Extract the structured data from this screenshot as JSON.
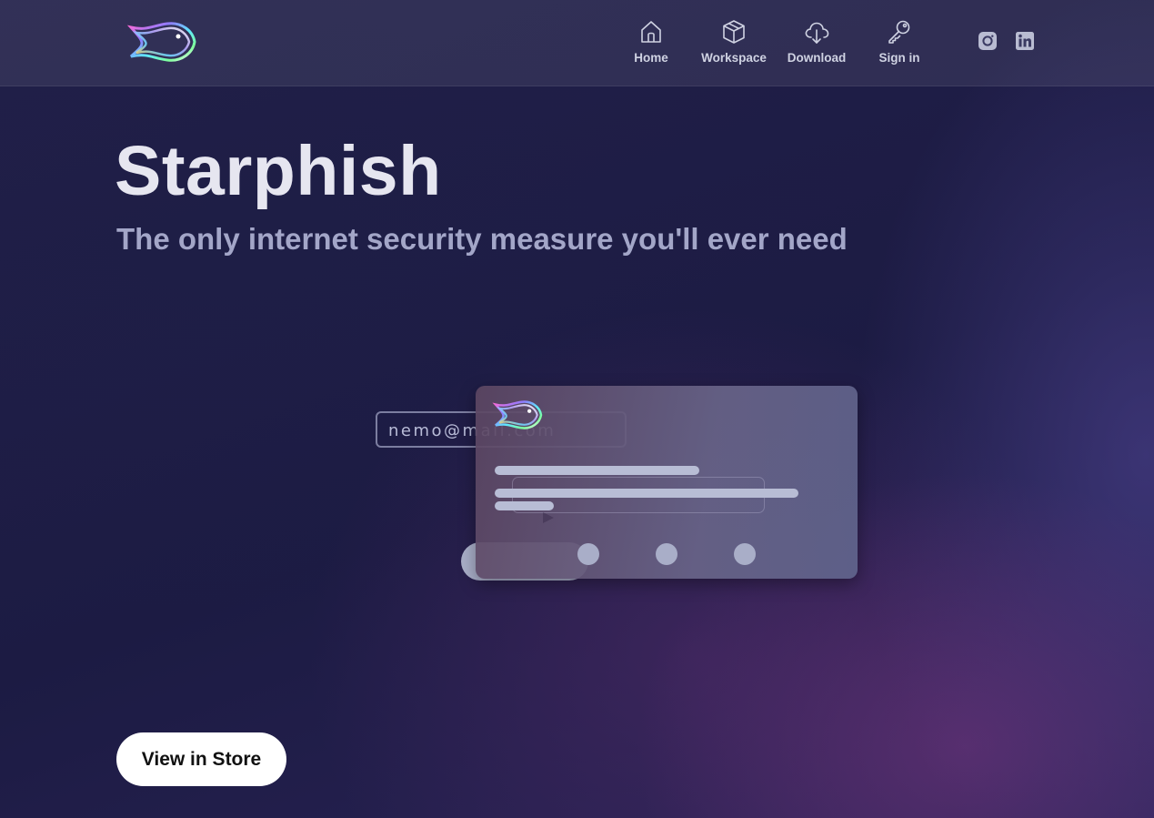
{
  "brand": {
    "logo_icon": "starphish-fish-logo"
  },
  "nav": {
    "items": [
      {
        "label": "Home",
        "icon": "home-icon"
      },
      {
        "label": "Workspace",
        "icon": "box-icon"
      },
      {
        "label": "Download",
        "icon": "cloud-download-icon"
      },
      {
        "label": "Sign in",
        "icon": "key-icon"
      }
    ],
    "social": [
      {
        "icon": "instagram-icon"
      },
      {
        "icon": "linkedin-icon"
      }
    ]
  },
  "hero": {
    "title": "Starphish",
    "subtitle": "The only internet security measure you'll ever need"
  },
  "illustration": {
    "email_value": "nemo@mail.com"
  },
  "cta": {
    "store_label": "View in Store"
  },
  "colors": {
    "background": "#1d1c44",
    "accent_purple": "#7a3a86",
    "nav_text": "#cfd2e2",
    "subtitle": "#a3a6c8",
    "button_bg": "#ffffff"
  }
}
